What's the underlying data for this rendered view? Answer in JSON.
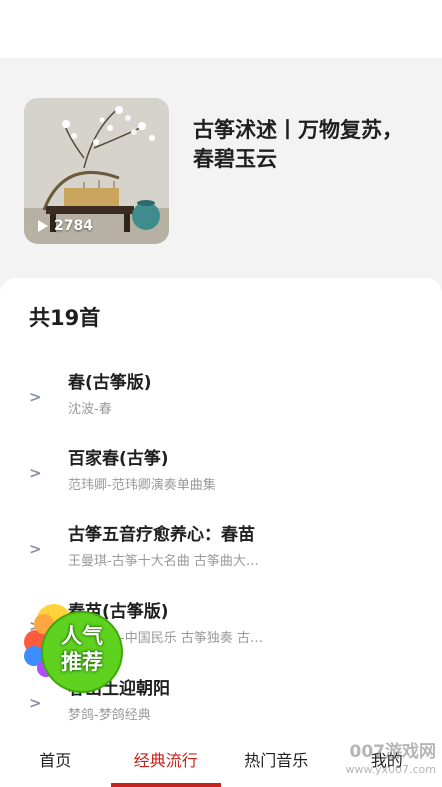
{
  "playlist": {
    "title": "古筝沭述丨万物复苏，春碧玉云",
    "play_count": "2784"
  },
  "list": {
    "count_label": "共19首",
    "songs": [
      {
        "name": "春(古筝版)",
        "sub": "沈波-春",
        "arrow": ">"
      },
      {
        "name": "百家春(古筝)",
        "sub": "范玮卿-范玮卿演奏单曲集",
        "arrow": ">"
      },
      {
        "name": "古筝五音疗愈养心：春苗",
        "sub": "王曼琪-古筝十大名曲 古筝曲大…",
        "arrow": ">"
      },
      {
        "name": "春苗(古筝版)",
        "sub": "中国民乐-中国民乐 古筝独奏 古…",
        "arrow": ">"
      },
      {
        "name": "春出土迎朝阳",
        "sub": "梦鸽-梦鸽经典",
        "arrow": ">"
      }
    ]
  },
  "badge": {
    "line1": "人气",
    "line2": "推荐"
  },
  "tabs": [
    {
      "label": "首页",
      "active": false
    },
    {
      "label": "经典流行",
      "active": true
    },
    {
      "label": "热门音乐",
      "active": false
    },
    {
      "label": "我的",
      "active": false
    }
  ],
  "watermark": {
    "main": "007游戏网",
    "url": "www.yx007.com"
  },
  "colors": {
    "accent": "#c7231d",
    "badge_green": "#5fd11f"
  }
}
